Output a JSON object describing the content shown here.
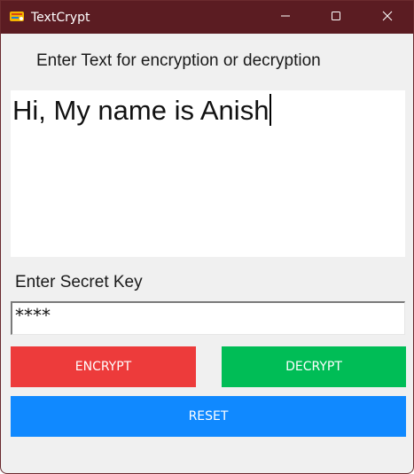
{
  "window": {
    "title": "TextCrypt",
    "icon": "app-logo-icon",
    "controls": [
      "minimize-icon",
      "maximize-icon",
      "close-icon"
    ]
  },
  "main": {
    "prompt_label": "Enter Text for encryption or decryption",
    "text_value": "Hi, My name is Anish",
    "key_label": "Enter Secret Key",
    "key_value": "****"
  },
  "buttons": {
    "encrypt_label": "ENCRYPT",
    "decrypt_label": "DECRYPT",
    "reset_label": "RESET"
  },
  "colors": {
    "titlebar": "#5b1c22",
    "window_bg": "#f0f0f0",
    "encrypt": "#ed3b3b",
    "decrypt": "#00bd56",
    "reset": "#1089ff"
  }
}
